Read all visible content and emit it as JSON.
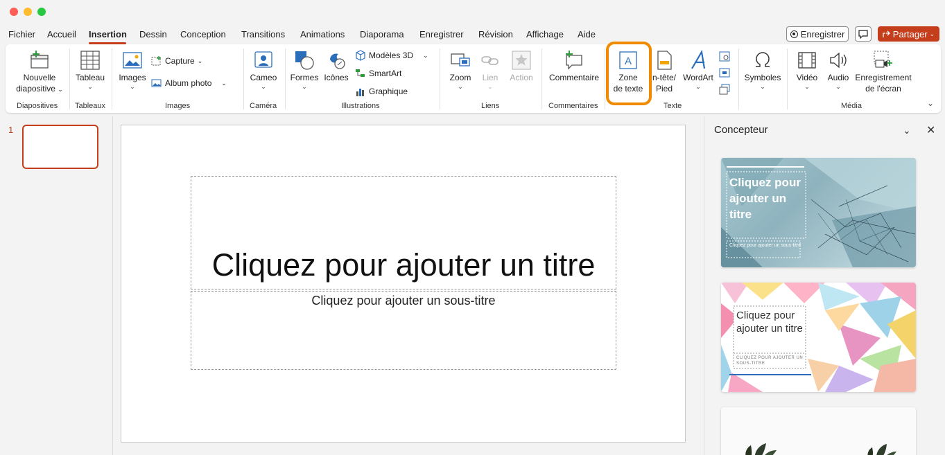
{
  "menu": [
    "Fichier",
    "Accueil",
    "Insertion",
    "Dessin",
    "Conception",
    "Transitions",
    "Animations",
    "Diaporama",
    "Enregistrer",
    "Révision",
    "Affichage",
    "Aide"
  ],
  "active_tab": "Insertion",
  "header_buttons": {
    "record": "Enregistrer",
    "share": "Partager"
  },
  "ribbon": {
    "new_slide": [
      "Nouvelle",
      "diapositive"
    ],
    "table": "Tableau",
    "images": "Images",
    "capture": "Capture",
    "album": "Album photo",
    "cameo": "Cameo",
    "shapes": "Formes",
    "icons": "Icônes",
    "models3d": "Modèles 3D",
    "smartart": "SmartArt",
    "chart": "Graphique",
    "zoom": "Zoom",
    "link": "Lien",
    "action": "Action",
    "comment": "Commentaire",
    "textbox": [
      "Zone",
      "de texte"
    ],
    "header_footer": [
      "n-tête/",
      "Pied"
    ],
    "wordart": "WordArt",
    "symbols": "Symboles",
    "video": "Vidéo",
    "audio": "Audio",
    "screen_recording": [
      "Enregistrement",
      "de l'écran"
    ]
  },
  "groups": {
    "slides": "Diapositives",
    "tables": "Tableaux",
    "images": "Images",
    "camera": "Caméra",
    "illustrations": "Illustrations",
    "links": "Liens",
    "comments": "Commentaires",
    "text": "Texte",
    "media": "Média"
  },
  "thumbnail_number": "1",
  "slide": {
    "title_placeholder": "Cliquez pour ajouter un titre",
    "subtitle_placeholder": "Cliquez pour ajouter un sous-titre"
  },
  "designer": {
    "title": "Concepteur",
    "card1": {
      "title": "Cliquez pour ajouter un titre",
      "subtitle": "Cliquez pour ajouter un sous-titre"
    },
    "card2": {
      "title": "Cliquez pour ajouter un titre",
      "subtitle": "CLIQUEZ POUR AJOUTER UN SOUS-TITRE"
    }
  },
  "colors": {
    "accent": "#c43e1c",
    "highlight": "#f08a00"
  }
}
